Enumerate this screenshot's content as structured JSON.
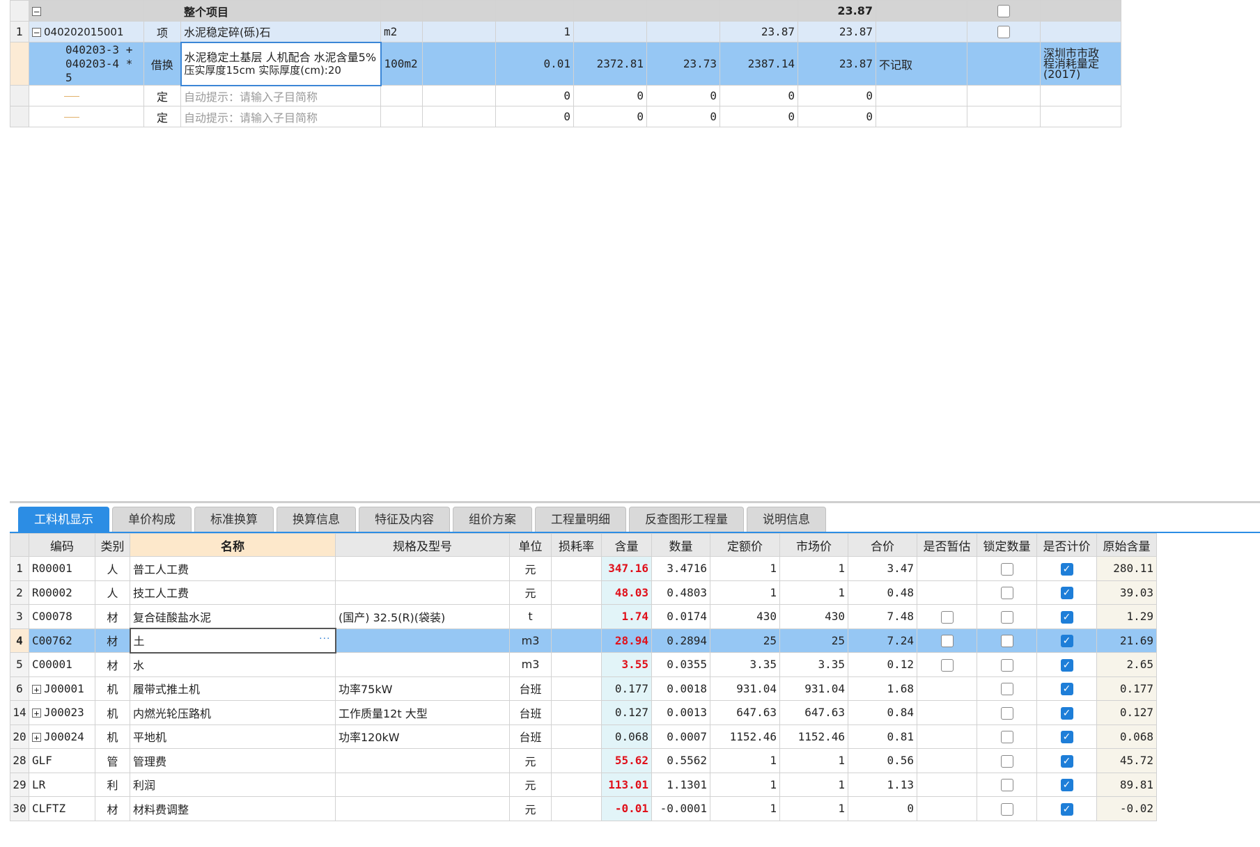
{
  "top_grid": {
    "project_row": {
      "title": "整个项目",
      "total": "23.87"
    },
    "item_row": {
      "row_no": "1",
      "code": "040202015001",
      "type": "项",
      "name": "水泥稳定碎(砾)石",
      "unit": "m2",
      "quantity": "1",
      "value1": "23.87",
      "value2": "23.87"
    },
    "sub_row": {
      "code_line1": "040203-3 +",
      "code_line2": "040203-4 * 5",
      "type": "借换",
      "name_line1": "水泥稳定土基层 人机配合 水泥含量5%",
      "name_line2": "压实厚度15cm  实际厚度(cm):20",
      "unit": "100m2",
      "quantity": "0.01",
      "unit_price": "2372.81",
      "v3": "23.73",
      "v4": "2387.14",
      "v5": "23.87",
      "note": "不记取",
      "library_line1": "深圳市市政",
      "library_line2": "程消耗量定",
      "library_line3": "(2017)"
    },
    "empty_rows": [
      {
        "type": "定",
        "placeholder": "自动提示：请输入子目简称",
        "v1": "0",
        "v2": "0",
        "v3": "0",
        "v4": "0",
        "v5": "0"
      },
      {
        "type": "定",
        "placeholder": "自动提示：请输入子目简称",
        "v1": "0",
        "v2": "0",
        "v3": "0",
        "v4": "0",
        "v5": "0"
      }
    ]
  },
  "tabs": [
    {
      "label": "工料机显示",
      "active": true
    },
    {
      "label": "单价构成"
    },
    {
      "label": "标准换算"
    },
    {
      "label": "换算信息"
    },
    {
      "label": "特征及内容"
    },
    {
      "label": "组价方案"
    },
    {
      "label": "工程量明细"
    },
    {
      "label": "反查图形工程量"
    },
    {
      "label": "说明信息"
    }
  ],
  "material_grid": {
    "headers": {
      "code": "编码",
      "category": "类别",
      "name": "名称",
      "spec": "规格及型号",
      "unit": "单位",
      "loss": "损耗率",
      "content": "含量",
      "quantity": "数量",
      "quota_price": "定额价",
      "market_price": "市场价",
      "total": "合价",
      "provisional": "是否暂估",
      "lock_qty": "锁定数量",
      "priced": "是否计价",
      "orig_content": "原始含量"
    },
    "rows": [
      {
        "no": "1",
        "code": "R00001",
        "cat": "人",
        "name": "普工人工费",
        "spec": "",
        "unit": "元",
        "content": "347.16",
        "qty": "3.4716",
        "quota": "1",
        "market": "1",
        "total": "3.47",
        "orig": "280.11"
      },
      {
        "no": "2",
        "code": "R00002",
        "cat": "人",
        "name": "技工人工费",
        "spec": "",
        "unit": "元",
        "content": "48.03",
        "qty": "0.4803",
        "quota": "1",
        "market": "1",
        "total": "0.48",
        "orig": "39.03"
      },
      {
        "no": "3",
        "code": "C00078",
        "cat": "材",
        "name": "复合硅酸盐水泥",
        "spec": "(国产) 32.5(R)(袋装)",
        "unit": "t",
        "content": "1.74",
        "qty": "0.0174",
        "quota": "430",
        "market": "430",
        "total": "7.48",
        "orig": "1.29"
      },
      {
        "no": "4",
        "code": "C00762",
        "cat": "材",
        "name": "土",
        "spec": "",
        "unit": "m3",
        "content": "28.94",
        "qty": "0.2894",
        "quota": "25",
        "market": "25",
        "total": "7.24",
        "orig": "21.69"
      },
      {
        "no": "5",
        "code": "C00001",
        "cat": "材",
        "name": "水",
        "spec": "",
        "unit": "m3",
        "content": "3.55",
        "qty": "0.0355",
        "quota": "3.35",
        "market": "3.35",
        "total": "0.12",
        "orig": "2.65"
      },
      {
        "no": "6",
        "code": "J00001",
        "cat": "机",
        "name": "履带式推土机",
        "spec": "功率75kW",
        "unit": "台班",
        "content": "0.177",
        "qty": "0.0018",
        "quota": "931.04",
        "market": "931.04",
        "total": "1.68",
        "orig": "0.177"
      },
      {
        "no": "14",
        "code": "J00023",
        "cat": "机",
        "name": "内燃光轮压路机",
        "spec": "工作质量12t 大型",
        "unit": "台班",
        "content": "0.127",
        "qty": "0.0013",
        "quota": "647.63",
        "market": "647.63",
        "total": "0.84",
        "orig": "0.127"
      },
      {
        "no": "20",
        "code": "J00024",
        "cat": "机",
        "name": "平地机",
        "spec": "功率120kW",
        "unit": "台班",
        "content": "0.068",
        "qty": "0.0007",
        "quota": "1152.46",
        "market": "1152.46",
        "total": "0.81",
        "orig": "0.068"
      },
      {
        "no": "28",
        "code": "GLF",
        "cat": "管",
        "name": "管理费",
        "spec": "",
        "unit": "元",
        "content": "55.62",
        "qty": "0.5562",
        "quota": "1",
        "market": "1",
        "total": "0.56",
        "orig": "45.72"
      },
      {
        "no": "29",
        "code": "LR",
        "cat": "利",
        "name": "利润",
        "spec": "",
        "unit": "元",
        "content": "113.01",
        "qty": "1.1301",
        "quota": "1",
        "market": "1",
        "total": "1.13",
        "orig": "89.81"
      },
      {
        "no": "30",
        "code": "CLFTZ",
        "cat": "材",
        "name": "材料费调整",
        "spec": "",
        "unit": "元",
        "content": "-0.01",
        "qty": "-0.0001",
        "quota": "1",
        "market": "1",
        "total": "0",
        "orig": "-0.02"
      }
    ]
  }
}
